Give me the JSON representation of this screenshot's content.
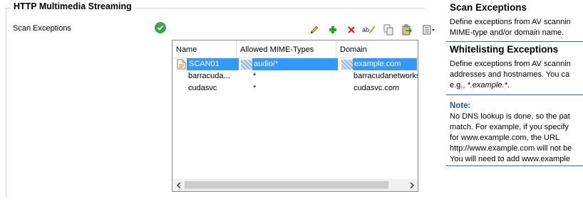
{
  "section_title": "HTTP Multimedia Streaming",
  "scan_exceptions_label": "Scan Exceptions",
  "toolbar": {
    "edit": "pencil-icon",
    "add": "plus-icon",
    "delete": "delete-icon",
    "rename": "rename-icon",
    "copy": "copy-icon",
    "paste": "paste-icon",
    "menu": "list-menu-icon"
  },
  "table": {
    "columns": [
      "Name",
      "Allowed MIME-Types",
      "Domain"
    ],
    "rows": [
      {
        "name": "SCAN01",
        "mime": "audio/*",
        "domain": "example.com"
      },
      {
        "name": "barracuda...",
        "mime": "*",
        "domain": "barracudanetworks"
      },
      {
        "name": "cudasvc",
        "mime": "*",
        "domain": "cudasvc.com"
      }
    ]
  },
  "help": {
    "scan_title": "Scan Exceptions",
    "scan_lines": [
      "Define exceptions from AV scannin",
      "MIME-type and/or domain name."
    ],
    "white_title": "Whitelisting Exceptions",
    "white_lines": [
      "Define exceptions from AV scannin",
      "addresses and hostnames. You ca",
      "e.g., "
    ],
    "white_example": "*.example.*",
    "white_tail": ".",
    "note_title": "Note:",
    "note_lines": [
      "No DNS lookup is done, so the pat",
      "match. For example, if you specify",
      "for www.example.com, the URL",
      "http://www.example.com will not be",
      "You will need to add www.example"
    ]
  },
  "colors": {
    "accent": "#3399ff",
    "ok": "#3aa346",
    "note": "#1f5a8a"
  }
}
